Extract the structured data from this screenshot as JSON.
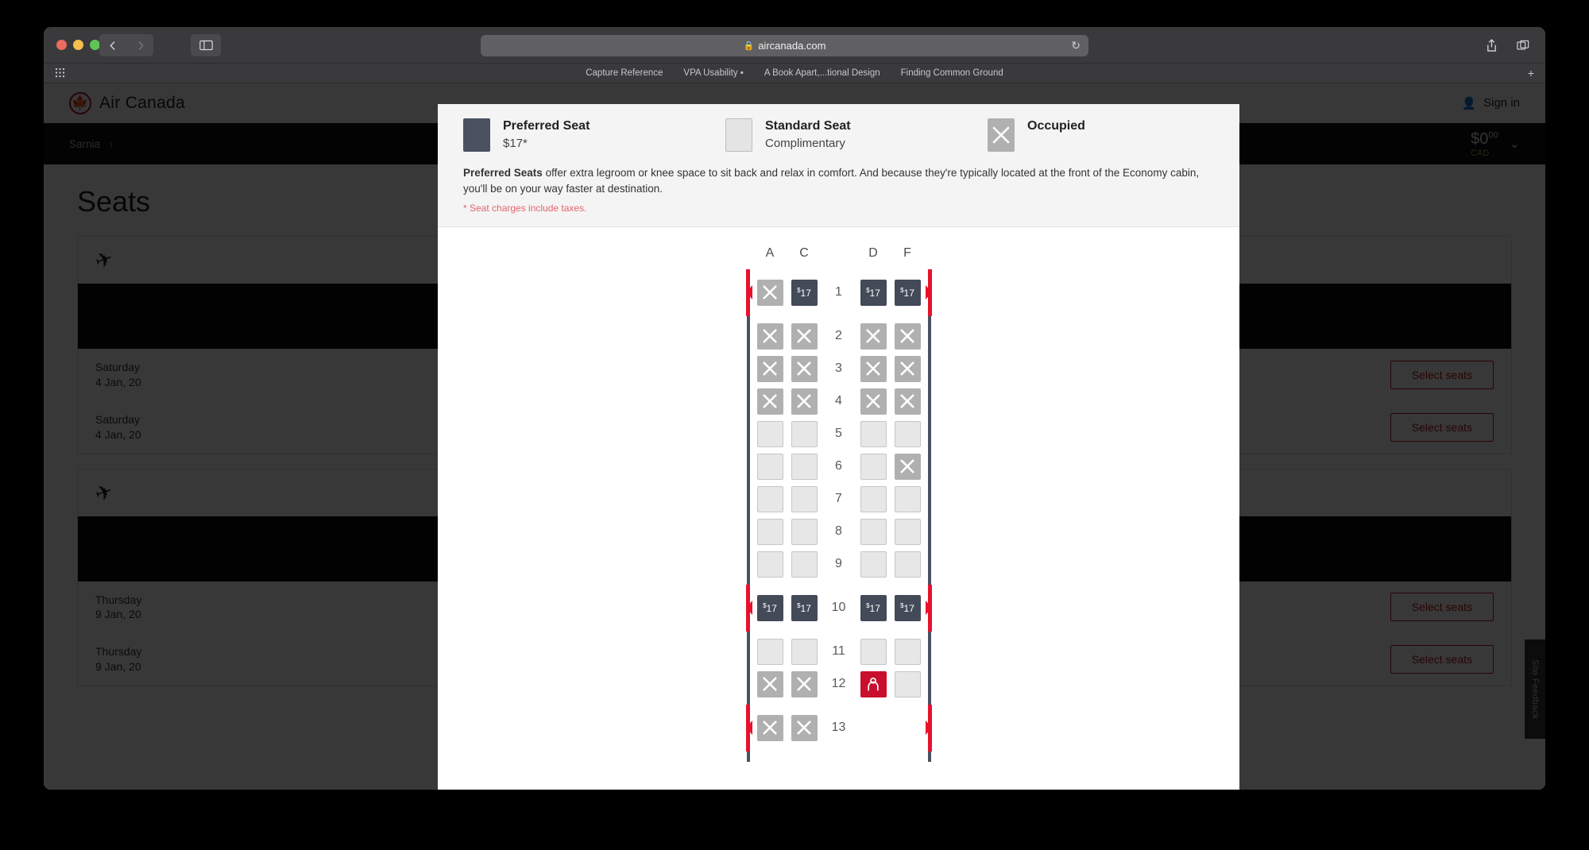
{
  "browser": {
    "url": "aircanada.com",
    "lock_icon": "lock-icon",
    "back_icon": "chevron-left-icon",
    "forward_icon": "chevron-right-icon",
    "sidebar_icon": "sidebar-toggle-icon",
    "reload_icon": "reload-icon",
    "share_icon": "share-icon",
    "tabs_icon": "tab-overview-icon",
    "bookmarks": [
      "Capture Reference",
      "VPA Usability ▪",
      "A Book Apart,...tional Design",
      "Finding Common Ground"
    ],
    "bookmark_add": "+"
  },
  "site": {
    "brand": "Air Canada",
    "brand_mark": "maple-leaf-icon",
    "sign_in": "Sign in",
    "breadcrumb": "Sarnia",
    "breadcrumb_chevron": "›",
    "price_value": "0",
    "price_cents": "00",
    "price_currency": "CAD",
    "page_title": "Seats",
    "feedback_tab": "Site Feedback",
    "flights": [
      {
        "date_line1": "Saturday",
        "date_line2": "4 Jan, 20",
        "cta": "Select seats"
      },
      {
        "date_line1": "Saturday",
        "date_line2": "4 Jan, 20",
        "cta": "Select seats"
      },
      {
        "date_line1": "Thursday",
        "date_line2": "9 Jan, 20",
        "cta": "Select seats"
      },
      {
        "date_line1": "Thursday",
        "date_line2": "9 Jan, 20",
        "cta": "Select seats"
      }
    ]
  },
  "legend": {
    "items": [
      {
        "title": "Preferred Seat",
        "sub": "$17*",
        "swatch": "preferred"
      },
      {
        "title": "Standard Seat",
        "sub": "Complimentary",
        "swatch": "standard"
      },
      {
        "title": "Occupied",
        "sub": "",
        "swatch": "occupied"
      }
    ],
    "desc_bold": "Preferred Seats",
    "desc_rest": " offer extra legroom or knee space to sit back and relax in comfort. And because they're typically located at the front of the Economy cabin, you'll be on your way faster at destination.",
    "note": "* Seat charges include taxes."
  },
  "seatmap": {
    "columns": [
      "A",
      "C",
      "D",
      "F"
    ],
    "price_label": "17",
    "price_symbol": "$",
    "rows": [
      {
        "number": "1",
        "seats": [
          "occupied",
          "preferred",
          "preferred",
          "preferred"
        ],
        "exit": true,
        "gap_after": true
      },
      {
        "number": "2",
        "seats": [
          "occupied",
          "occupied",
          "occupied",
          "occupied"
        ]
      },
      {
        "number": "3",
        "seats": [
          "occupied",
          "occupied",
          "occupied",
          "occupied"
        ]
      },
      {
        "number": "4",
        "seats": [
          "occupied",
          "occupied",
          "occupied",
          "occupied"
        ]
      },
      {
        "number": "5",
        "seats": [
          "available",
          "available",
          "available",
          "available"
        ]
      },
      {
        "number": "6",
        "seats": [
          "available",
          "available",
          "available",
          "occupied"
        ]
      },
      {
        "number": "7",
        "seats": [
          "available",
          "available",
          "available",
          "available"
        ]
      },
      {
        "number": "8",
        "seats": [
          "available",
          "available",
          "available",
          "available"
        ]
      },
      {
        "number": "9",
        "seats": [
          "available",
          "available",
          "available",
          "available"
        ]
      },
      {
        "number": "10",
        "seats": [
          "preferred",
          "preferred",
          "preferred",
          "preferred"
        ],
        "exit": true,
        "gap_before": true,
        "gap_after": true
      },
      {
        "number": "11",
        "seats": [
          "available",
          "available",
          "available",
          "available"
        ]
      },
      {
        "number": "12",
        "seats": [
          "occupied",
          "occupied",
          "selected",
          "available"
        ]
      },
      {
        "number": "13",
        "seats": [
          "occupied",
          "occupied",
          "none",
          "none"
        ],
        "exit": true,
        "gap_before": true
      }
    ]
  }
}
